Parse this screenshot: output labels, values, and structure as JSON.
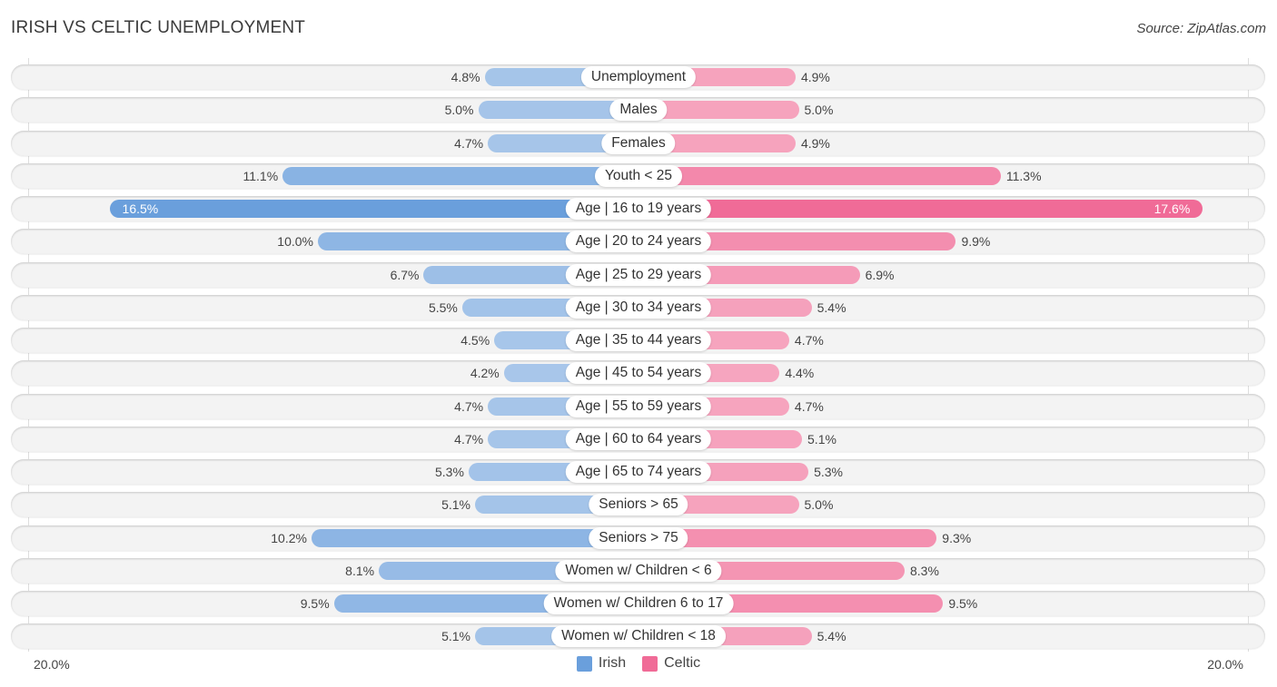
{
  "header": {
    "title": "IRISH VS CELTIC UNEMPLOYMENT",
    "source": "Source: ZipAtlas.com"
  },
  "colors": {
    "irish_strong": "#6a9fdc",
    "irish_light": "#a9c7ea",
    "celtic_strong": "#f06b97",
    "celtic_light": "#f6a7c0",
    "row_background": "#f3f3f3"
  },
  "chart_data": {
    "type": "bar",
    "orientation": "horizontal-diverging",
    "title": "IRISH VS CELTIC UNEMPLOYMENT",
    "unit": "%",
    "xlim": [
      -20,
      20
    ],
    "axis_tick_labels": {
      "left": "20.0%",
      "right": "20.0%"
    },
    "legend": {
      "position": "bottom-center",
      "entries": [
        "Irish",
        "Celtic"
      ]
    },
    "categories": [
      "Unemployment",
      "Males",
      "Females",
      "Youth < 25",
      "Age | 16 to 19 years",
      "Age | 20 to 24 years",
      "Age | 25 to 29 years",
      "Age | 30 to 34 years",
      "Age | 35 to 44 years",
      "Age | 45 to 54 years",
      "Age | 55 to 59 years",
      "Age | 60 to 64 years",
      "Age | 65 to 74 years",
      "Seniors > 65",
      "Seniors > 75",
      "Women w/ Children < 6",
      "Women w/ Children 6 to 17",
      "Women w/ Children < 18"
    ],
    "series": [
      {
        "name": "Irish",
        "side": "left",
        "values": [
          4.8,
          5.0,
          4.7,
          11.1,
          16.5,
          10.0,
          6.7,
          5.5,
          4.5,
          4.2,
          4.7,
          4.7,
          5.3,
          5.1,
          10.2,
          8.1,
          9.5,
          5.1
        ],
        "labels": [
          "4.8%",
          "5.0%",
          "4.7%",
          "11.1%",
          "16.5%",
          "10.0%",
          "6.7%",
          "5.5%",
          "4.5%",
          "4.2%",
          "4.7%",
          "4.7%",
          "5.3%",
          "5.1%",
          "10.2%",
          "8.1%",
          "9.5%",
          "5.1%"
        ]
      },
      {
        "name": "Celtic",
        "side": "right",
        "values": [
          4.9,
          5.0,
          4.9,
          11.3,
          17.6,
          9.9,
          6.9,
          5.4,
          4.7,
          4.4,
          4.7,
          5.1,
          5.3,
          5.0,
          9.3,
          8.3,
          9.5,
          5.4
        ],
        "labels": [
          "4.9%",
          "5.0%",
          "4.9%",
          "11.3%",
          "17.6%",
          "9.9%",
          "6.9%",
          "5.4%",
          "4.7%",
          "4.4%",
          "4.7%",
          "5.1%",
          "5.3%",
          "5.0%",
          "9.3%",
          "8.3%",
          "9.5%",
          "5.4%"
        ]
      }
    ],
    "highlighted_category": "Age | 16 to 19 years"
  }
}
